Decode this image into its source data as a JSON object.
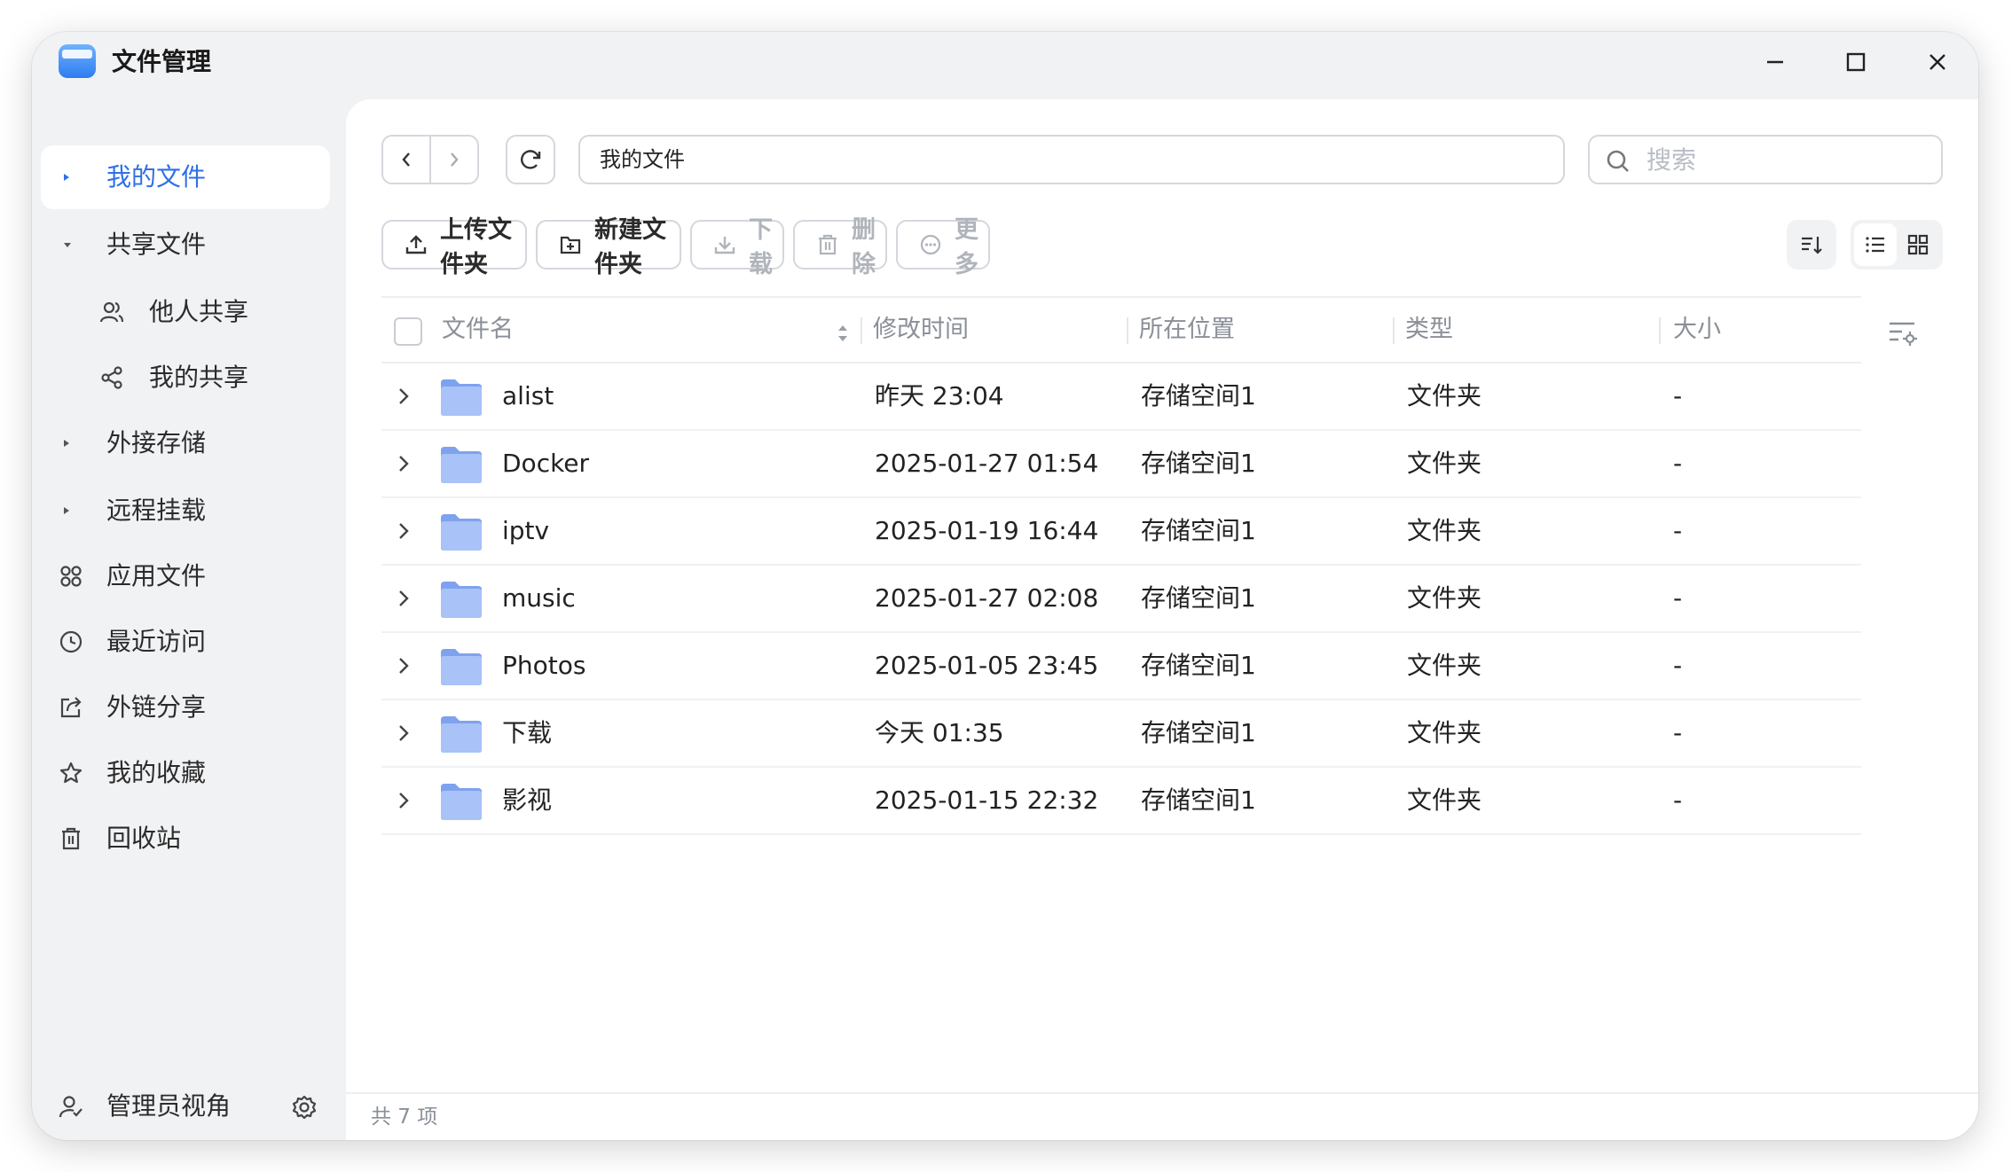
{
  "window": {
    "title": "文件管理",
    "accent": "#2e6fe6"
  },
  "sidebar": {
    "items": [
      {
        "label": "我的文件",
        "icon": "caret-right-icon",
        "active": true
      },
      {
        "label": "共享文件",
        "icon": "caret-down-icon"
      },
      {
        "label": "他人共享",
        "icon": "users-icon",
        "sub": true
      },
      {
        "label": "我的共享",
        "icon": "share-icon",
        "sub": true
      },
      {
        "label": "外接存储",
        "icon": "caret-right-icon"
      },
      {
        "label": "远程挂载",
        "icon": "caret-right-icon"
      },
      {
        "label": "应用文件",
        "icon": "apps-icon"
      },
      {
        "label": "最近访问",
        "icon": "clock-icon"
      },
      {
        "label": "外链分享",
        "icon": "external-link-icon"
      },
      {
        "label": "我的收藏",
        "icon": "star-icon"
      },
      {
        "label": "回收站",
        "icon": "trash-icon"
      }
    ],
    "footer": {
      "label": "管理员视角"
    }
  },
  "toolbar": {
    "path": "我的文件",
    "search_placeholder": "搜索",
    "upload_label": "上传文件夹",
    "new_folder_label": "新建文件夹",
    "download_label": "下载",
    "delete_label": "删除",
    "more_label": "更多"
  },
  "table": {
    "columns": [
      "文件名",
      "修改时间",
      "所在位置",
      "类型",
      "大小"
    ],
    "rows": [
      {
        "name": "alist",
        "modified": "昨天 23:04",
        "location": "存储空间1",
        "type": "文件夹",
        "size": "-"
      },
      {
        "name": "Docker",
        "modified": "2025-01-27 01:54",
        "location": "存储空间1",
        "type": "文件夹",
        "size": "-"
      },
      {
        "name": "iptv",
        "modified": "2025-01-19 16:44",
        "location": "存储空间1",
        "type": "文件夹",
        "size": "-"
      },
      {
        "name": "music",
        "modified": "2025-01-27 02:08",
        "location": "存储空间1",
        "type": "文件夹",
        "size": "-"
      },
      {
        "name": "Photos",
        "modified": "2025-01-05 23:45",
        "location": "存储空间1",
        "type": "文件夹",
        "size": "-"
      },
      {
        "name": "下载",
        "modified": "今天 01:35",
        "location": "存储空间1",
        "type": "文件夹",
        "size": "-"
      },
      {
        "name": "影视",
        "modified": "2025-01-15 22:32",
        "location": "存储空间1",
        "type": "文件夹",
        "size": "-"
      }
    ]
  },
  "status": {
    "count_text": "共 7 项"
  }
}
